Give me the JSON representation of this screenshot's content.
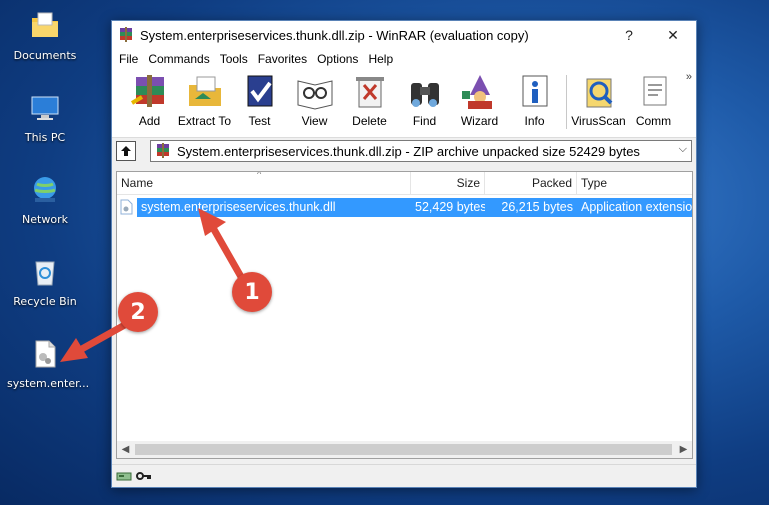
{
  "desktop": {
    "icons": [
      {
        "label": "Documents"
      },
      {
        "label": "This PC"
      },
      {
        "label": "Network"
      },
      {
        "label": "Recycle Bin"
      },
      {
        "label": "system.enter..."
      }
    ]
  },
  "window": {
    "title": "System.enterpriseservices.thunk.dll.zip - WinRAR (evaluation copy)",
    "help_glyph": "?",
    "close_glyph": "✕"
  },
  "menu": [
    "File",
    "Commands",
    "Tools",
    "Favorites",
    "Options",
    "Help"
  ],
  "toolbar": [
    "Add",
    "Extract To",
    "Test",
    "View",
    "Delete",
    "Find",
    "Wizard",
    "Info",
    "VirusScan",
    "Comm"
  ],
  "toolbar_more": "»",
  "address": {
    "text": "System.enterpriseservices.thunk.dll.zip - ZIP archive unpacked size 52429 bytes"
  },
  "list": {
    "columns": [
      "Name",
      "Size",
      "Packed",
      "Type"
    ],
    "rows": [
      {
        "name": "system.enterpriseservices.thunk.dll",
        "size": "52,429 bytes",
        "packed": "26,215 bytes",
        "type": "Application extension"
      }
    ]
  },
  "annotations": {
    "step1": "1",
    "step2": "2"
  },
  "colors": {
    "selection": "#3399ff",
    "callout": "#e04a3a"
  }
}
